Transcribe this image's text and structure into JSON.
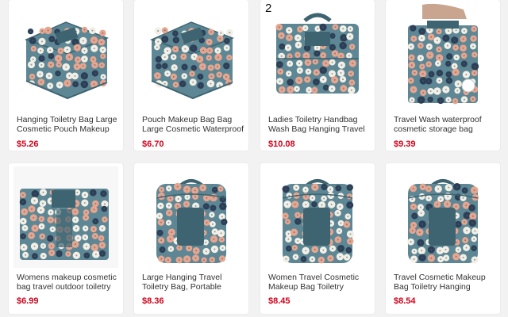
{
  "products": [
    {
      "title": "Hanging Toiletry Bag Large Cosmetic Pouch Makeup",
      "price": "$5.26",
      "icon": "floral-case-closed-image"
    },
    {
      "title": "Pouch Makeup Bag Bag Large Cosmetic Waterproof",
      "price": "$6.70",
      "icon": "floral-case-closed-image"
    },
    {
      "title": "Ladies Toiletry Handbag Wash Bag Hanging Travel",
      "price": "$10.08",
      "badge": "2",
      "icon": "floral-case-handle-image"
    },
    {
      "title": "Travel Wash waterproof cosmetic storage bag",
      "price": "$9.39",
      "icon": "floral-case-hand-held-image"
    },
    {
      "title": "Womens makeup cosmetic bag travel outdoor toiletry",
      "price": "$6.99",
      "icon": "floral-case-open-image"
    },
    {
      "title": "Large Hanging Travel Toiletry Bag, Portable",
      "price": "$8.36",
      "icon": "floral-case-hanging-image"
    },
    {
      "title": "Women Travel Cosmetic Makeup Bag Toiletry",
      "price": "$8.45",
      "icon": "floral-case-hanging-image"
    },
    {
      "title": "Travel Cosmetic Makeup Bag Toiletry Hanging Organizer",
      "price": "$8.54",
      "icon": "floral-case-hanging-image"
    }
  ],
  "colors": {
    "price": "#d0021b",
    "bag_body": "#5d8794",
    "bag_dark": "#3f6471",
    "flower_pink": "#e7a58f",
    "flower_white": "#f3efe6",
    "flower_navy": "#2d3f56"
  }
}
